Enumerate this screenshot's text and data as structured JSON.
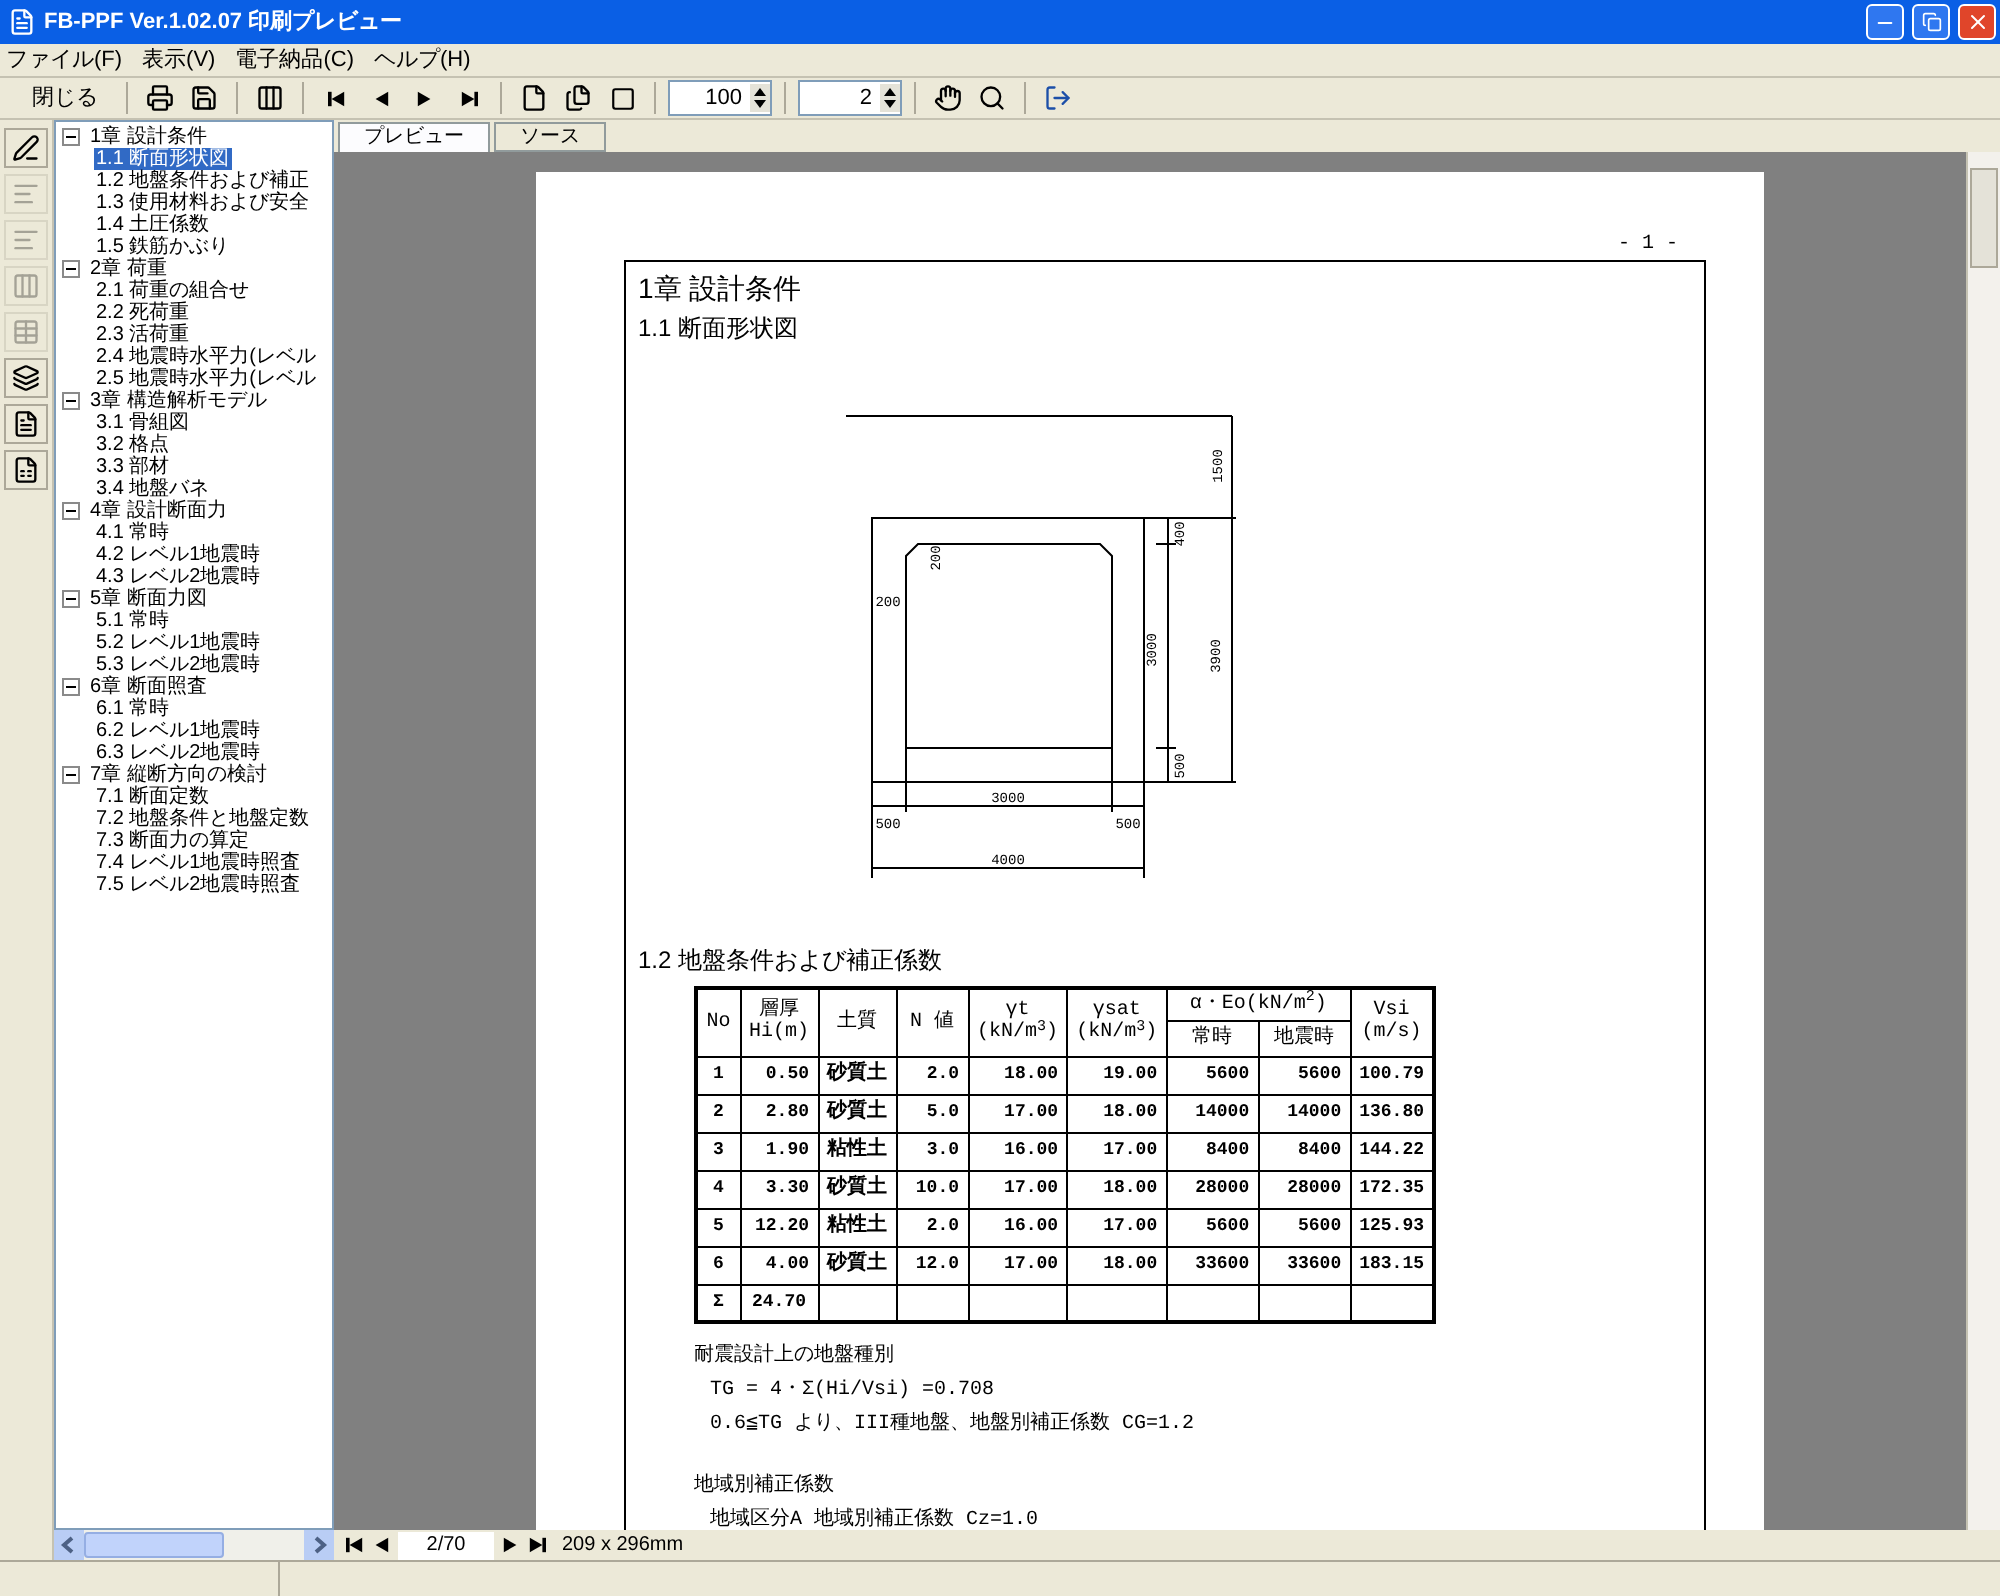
{
  "window": {
    "title": "FB-PPF Ver.1.02.07 印刷プレビュー"
  },
  "menu": [
    "ファイル(F)",
    "表示(V)",
    "電子納品(C)",
    "ヘルプ(H)"
  ],
  "toolbar": {
    "close_label": "閉じる",
    "zoom": "100",
    "page": "2"
  },
  "side_tools": [
    {
      "disabled": false
    },
    {
      "disabled": true
    },
    {
      "disabled": true
    },
    {
      "disabled": true
    },
    {
      "disabled": true
    },
    {
      "disabled": false
    },
    {
      "disabled": false
    },
    {
      "disabled": false
    }
  ],
  "tree": [
    {
      "label": "1章 設計条件",
      "expanded": true,
      "selected": false,
      "children": [
        {
          "label": "1.1 断面形状図",
          "selected": true
        },
        {
          "label": "1.2 地盤条件および補正",
          "selected": false
        },
        {
          "label": "1.3 使用材料および安全",
          "selected": false
        },
        {
          "label": "1.4 土圧係数",
          "selected": false
        },
        {
          "label": "1.5 鉄筋かぶり",
          "selected": false
        }
      ]
    },
    {
      "label": "2章 荷重",
      "expanded": true,
      "selected": false,
      "children": [
        {
          "label": "2.1 荷重の組合せ",
          "selected": false
        },
        {
          "label": "2.2 死荷重",
          "selected": false
        },
        {
          "label": "2.3 活荷重",
          "selected": false
        },
        {
          "label": "2.4 地震時水平力(レベル",
          "selected": false
        },
        {
          "label": "2.5 地震時水平力(レベル",
          "selected": false
        }
      ]
    },
    {
      "label": "3章 構造解析モデル",
      "expanded": true,
      "selected": false,
      "children": [
        {
          "label": "3.1 骨組図",
          "selected": false
        },
        {
          "label": "3.2 格点",
          "selected": false
        },
        {
          "label": "3.3 部材",
          "selected": false
        },
        {
          "label": "3.4 地盤バネ",
          "selected": false
        }
      ]
    },
    {
      "label": "4章 設計断面力",
      "expanded": true,
      "selected": false,
      "children": [
        {
          "label": "4.1 常時",
          "selected": false
        },
        {
          "label": "4.2 レベル1地震時",
          "selected": false
        },
        {
          "label": "4.3 レベル2地震時",
          "selected": false
        }
      ]
    },
    {
      "label": "5章 断面力図",
      "expanded": true,
      "selected": false,
      "children": [
        {
          "label": "5.1 常時",
          "selected": false
        },
        {
          "label": "5.2 レベル1地震時",
          "selected": false
        },
        {
          "label": "5.3 レベル2地震時",
          "selected": false
        }
      ]
    },
    {
      "label": "6章 断面照査",
      "expanded": true,
      "selected": false,
      "children": [
        {
          "label": "6.1 常時",
          "selected": false
        },
        {
          "label": "6.2 レベル1地震時",
          "selected": false
        },
        {
          "label": "6.3 レベル2地震時",
          "selected": false
        }
      ]
    },
    {
      "label": "7章 縦断方向の検討",
      "expanded": true,
      "selected": false,
      "children": [
        {
          "label": "7.1 断面定数",
          "selected": false
        },
        {
          "label": "7.2 地盤条件と地盤定数",
          "selected": false
        },
        {
          "label": "7.3 断面力の算定",
          "selected": false
        },
        {
          "label": "7.4 レベル1地震時照査",
          "selected": false
        },
        {
          "label": "7.5 レベル2地震時照査",
          "selected": false
        }
      ]
    }
  ],
  "tabs": [
    {
      "label": "プレビュー",
      "selected": true
    },
    {
      "label": "ソース",
      "selected": false
    }
  ],
  "page": {
    "number": "- 1 -",
    "chapter": "1章  設計条件",
    "section": "1.1 断面形状図",
    "figure_dims": [
      "1500",
      "400",
      "200",
      "200",
      "3000",
      "3900",
      "500",
      "3000",
      "500",
      "500",
      "4000"
    ],
    "section2": "1.2 地盤条件および補正係数",
    "table": {
      "columns": [
        {
          "lines": [
            "No"
          ]
        },
        {
          "lines": [
            "層厚",
            "Hi(m)"
          ]
        },
        {
          "lines": [
            "土質"
          ]
        },
        {
          "lines": [
            "N 値"
          ]
        },
        {
          "lines": [
            "γt",
            "(kN/m$^{3}$)"
          ]
        },
        {
          "lines": [
            "γsat",
            "(kN/m$^{3}$)"
          ]
        },
        {
          "kind": "sub",
          "lines": [
            "常時"
          ]
        },
        {
          "kind": "sub",
          "lines": [
            "地震時"
          ]
        },
        {
          "lines": [
            "Vsi",
            "(m/s)"
          ]
        }
      ],
      "groups": [
        {
          "lines": [
            "α・Eo(kN/m$^{2}$)"
          ]
        }
      ],
      "rows": [
        [
          "1",
          "0.50",
          "砂質土",
          "2.0",
          "18.00",
          "19.00",
          "5600",
          "5600",
          "100.79"
        ],
        [
          "2",
          "2.80",
          "砂質土",
          "5.0",
          "17.00",
          "18.00",
          "14000",
          "14000",
          "136.80"
        ],
        [
          "3",
          "1.90",
          "粘性土",
          "3.0",
          "16.00",
          "17.00",
          "8400",
          "8400",
          "144.22"
        ],
        [
          "4",
          "3.30",
          "砂質土",
          "10.0",
          "17.00",
          "18.00",
          "28000",
          "28000",
          "172.35"
        ],
        [
          "5",
          "12.20",
          "粘性土",
          "2.0",
          "16.00",
          "17.00",
          "5600",
          "5600",
          "125.93"
        ],
        [
          "6",
          "4.00",
          "砂質土",
          "12.0",
          "17.00",
          "18.00",
          "33600",
          "33600",
          "183.15"
        ]
      ],
      "total": [
        "Σ",
        "24.70"
      ]
    },
    "notes": [
      {
        "kind": "heading",
        "text": "耐震設計上の地盤種別"
      },
      {
        "kind": "line",
        "text": "TG = 4・Σ(Hi/Vsi) =0.708"
      },
      {
        "kind": "line",
        "text": "0.6≦TG より、III種地盤、地盤別補正係数 CG=1.2"
      },
      {
        "kind": "gap"
      },
      {
        "kind": "heading",
        "text": "地域別補正係数"
      },
      {
        "kind": "line",
        "text": "地域区分A 地域別補正係数 Cz=1.0"
      }
    ]
  },
  "navigator": {
    "page": "2/70",
    "paper": "209 x 296mm"
  }
}
